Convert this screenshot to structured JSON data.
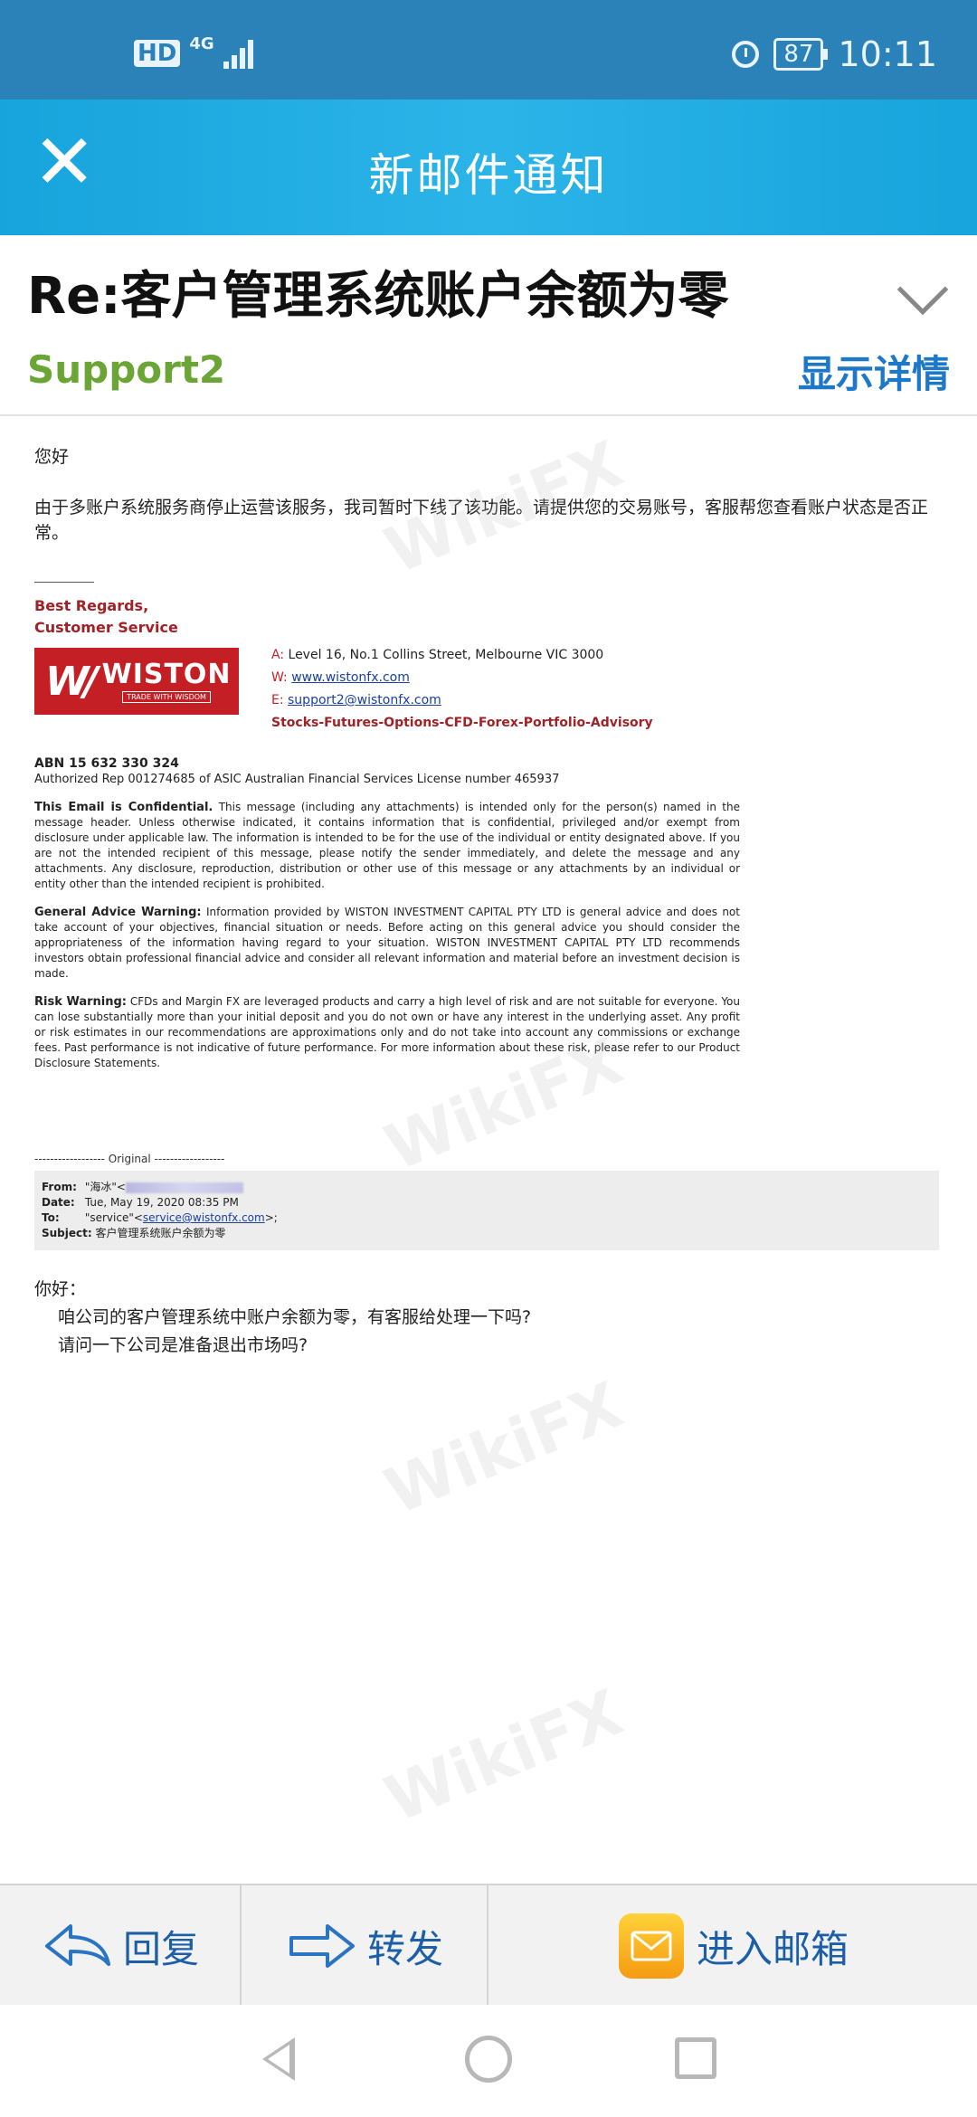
{
  "status_bar": {
    "hd": "HD",
    "network": "4G",
    "battery": "87",
    "time": "10:11"
  },
  "title_bar": {
    "close_glyph": "✕",
    "title": "新邮件通知"
  },
  "email": {
    "subject": "Re:客户管理系统账户余额为零",
    "sender": "Support2",
    "show_details": "显示详情"
  },
  "body": {
    "greeting": "您好",
    "message": "由于多账户系统服务商停止运营该服务，我司暂时下线了该功能。请提供您的交易账号，客服帮您查看账户状态是否正常。",
    "regards": "Best Regards,",
    "team": "Customer Service",
    "logo_name": "WISTON",
    "logo_tagline": "TRADE WITH WISDOM",
    "address_label": "A:",
    "address": "Level 16, No.1 Collins Street, Melbourne VIC 3000",
    "web_label": "W:",
    "web": "www.wistonfx.com",
    "email_label": "E:",
    "email": "support2@wistonfx.com",
    "services": "Stocks-Futures-Options-CFD-Forex-Portfolio-Advisory",
    "abn": "ABN 15 632 330 324",
    "authorized": "Authorized Rep 001274685 of ASIC Australian Financial Services License number 465937",
    "conf_title": "This Email is Confidential.",
    "conf_text": " This message (including any attachments) is intended only for the person(s) named in the message header. Unless otherwise indicated, it contains information that is confidential, privileged and/or exempt from disclosure under applicable law. The information is intended to be for the use of the individual or entity designated above. If you are not the intended recipient of this message, please notify the sender immediately, and delete the message and any attachments. Any disclosure, reproduction, distribution or other use of this message or any attachments by an individual or entity other than the intended recipient is prohibited.",
    "gaw_title": "General Advice Warning:",
    "gaw_text": " Information provided by WISTON INVESTMENT CAPITAL PTY LTD is general advice and does not take account of your objectives, financial situation or needs. Before acting on this general advice you should consider the appropriateness of the information having regard to your situation. WISTON INVESTMENT CAPITAL PTY LTD recommends investors obtain professional financial advice and  consider all relevant information and material before an investment decision is made.",
    "risk_title": "Risk Warning:",
    "risk_text": " CFDs and Margin FX are leveraged products and carry a high level of risk and are not suitable for everyone. You can lose substantially more than your initial deposit and you do not own or have any interest in the underlying asset. Any profit or risk estimates in our recommendations are approximations only and do not take into account any commissions or exchange fees. Past performance is not indicative of future performance. For more information about these risk, please refer to our Product Disclosure Statements."
  },
  "original": {
    "header": "------------------ Original ------------------",
    "from_label": "From:",
    "from_value": "\"海冰\"<",
    "date_label": "Date:",
    "date_value": "Tue, May 19, 2020 08:35 PM",
    "to_label": "To:",
    "to_name": "\"service\"<",
    "to_email": "service@wistonfx.com",
    "to_end": ">;",
    "subject_label": "Subject:",
    "subject_value": "客户管理系统账户余额为零",
    "greeting": "你好：",
    "line1": "咱公司的客户管理系统中账户余额为零，有客服给处理一下吗?",
    "line2": "请问一下公司是准备退出市场吗?"
  },
  "bottom_bar": {
    "reply": "回复",
    "forward": "转发",
    "mailbox": "进入邮箱"
  },
  "watermark": "WikiFX"
}
